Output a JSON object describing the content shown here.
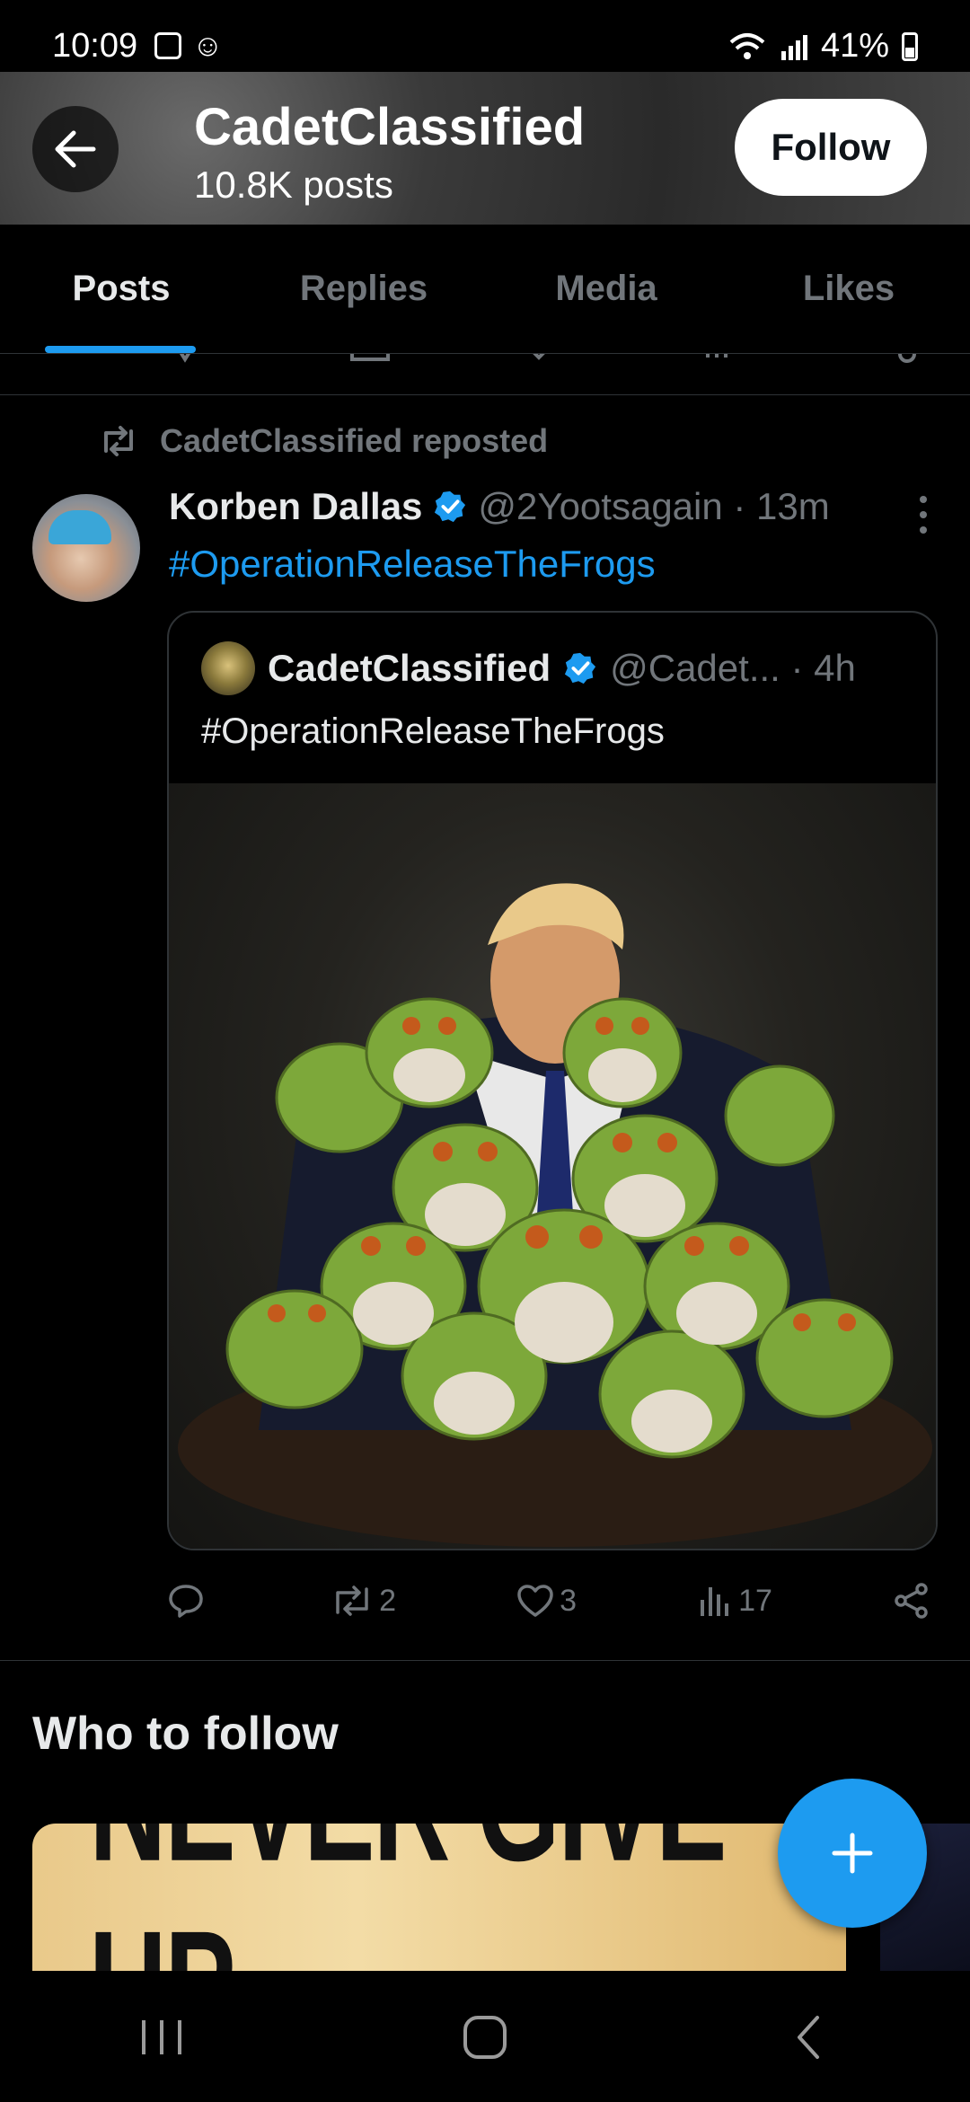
{
  "status_bar": {
    "time": "10:09",
    "battery": "41%"
  },
  "header": {
    "title": "CadetClassified",
    "subtitle": "10.8K posts",
    "follow_label": "Follow"
  },
  "tabs": [
    {
      "label": "Posts",
      "active": true
    },
    {
      "label": "Replies",
      "active": false
    },
    {
      "label": "Media",
      "active": false
    },
    {
      "label": "Likes",
      "active": false
    }
  ],
  "post": {
    "repost_label": "CadetClassified reposted",
    "author_name": "Korben Dallas",
    "author_handle": "@2Yootsagain · 13m",
    "text": "#OperationReleaseTheFrogs",
    "quote": {
      "author_name": "CadetClassified",
      "author_handle": "@Cadet... · 4h",
      "text": "#OperationReleaseTheFrogs"
    },
    "stats": {
      "replies": "",
      "reposts": "2",
      "likes": "3",
      "views": "17"
    }
  },
  "who_to_follow": {
    "title": "Who to follow",
    "banner_text": "NEVER GIVE UP."
  },
  "colors": {
    "accent": "#1d9bf0",
    "background": "#000000",
    "secondary_text": "#71767b"
  }
}
